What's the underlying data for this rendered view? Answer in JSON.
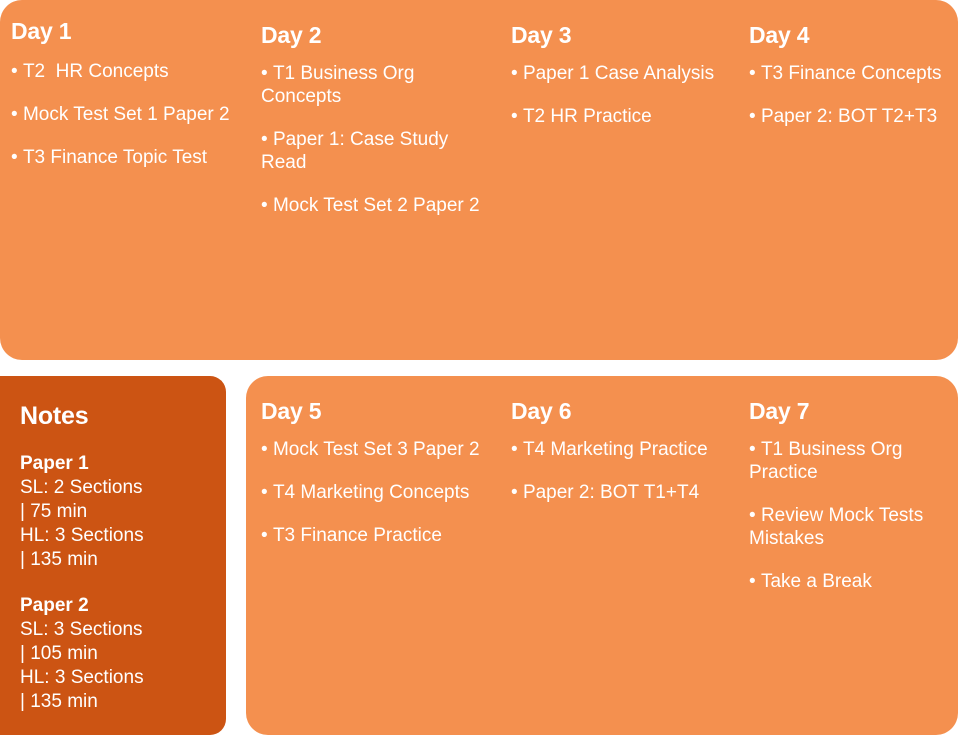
{
  "theme": {
    "primary_orange": "#f4904f",
    "notes_orange": "#cc5413",
    "text_color": "#ffffff",
    "page_background": "#ffffff"
  },
  "top_panel": {
    "days": [
      {
        "title": "Day 1",
        "tasks": [
          "T2  HR Concepts",
          "Mock Test Set 1 Paper 2",
          "T3 Finance Topic Test"
        ]
      },
      {
        "title": "Day 2",
        "tasks": [
          "T1 Business Org Concepts",
          "Paper 1: Case Study Read",
          "Mock Test Set 2 Paper 2"
        ]
      },
      {
        "title": "Day 3",
        "tasks": [
          "Paper 1 Case Analysis",
          "T2 HR Practice"
        ]
      },
      {
        "title": "Day 4",
        "tasks": [
          "T3 Finance Concepts",
          "Paper 2: BOT T2+T3"
        ]
      }
    ]
  },
  "notes_panel": {
    "title": "Notes",
    "blocks": [
      {
        "heading": "Paper 1",
        "lines": [
          "SL: 2 Sections",
          "| 75 min",
          "HL: 3 Sections",
          "| 135 min"
        ]
      },
      {
        "heading": "Paper 2",
        "lines": [
          "SL: 3 Sections",
          "| 105 min",
          "HL: 3 Sections",
          "| 135 min"
        ]
      }
    ]
  },
  "bottom_panel": {
    "days": [
      {
        "title": "Day 5",
        "tasks": [
          "Mock Test Set 3 Paper 2",
          "T4 Marketing Concepts",
          "T3 Finance Practice"
        ]
      },
      {
        "title": "Day 6",
        "tasks": [
          "T4 Marketing Practice",
          "Paper 2: BOT T1+T4"
        ]
      },
      {
        "title": "Day 7",
        "tasks": [
          "T1 Business Org Practice",
          "Review Mock Tests Mistakes",
          "Take a Break"
        ]
      }
    ]
  }
}
